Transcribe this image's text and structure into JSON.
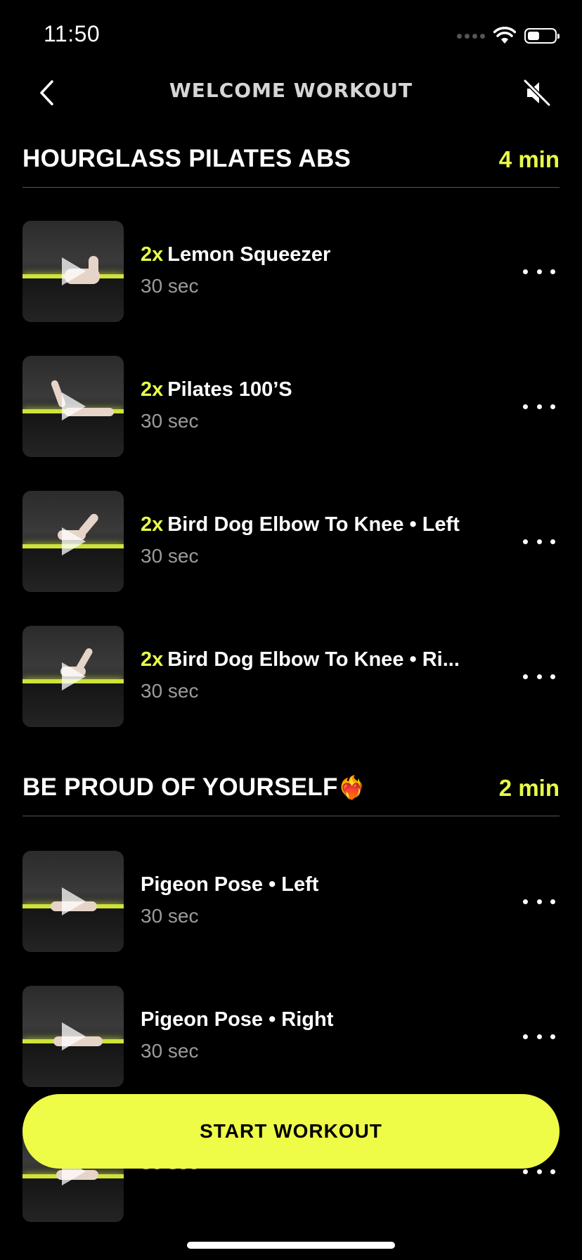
{
  "status_bar": {
    "time": "11:50",
    "battery_level": 0.45
  },
  "nav": {
    "title": "WELCOME WORKOUT",
    "back_icon": "chevron-left-icon",
    "mute_icon": "speaker-muted-icon"
  },
  "colors": {
    "accent": "#e8fc4a",
    "background": "#000000",
    "muted_text": "#9b9b9b"
  },
  "sections": [
    {
      "title": "HOURGLASS PILATES ABS",
      "duration": "4 min",
      "exercises": [
        {
          "reps": "2x",
          "name": "Lemon Squeezer",
          "time": "30 sec"
        },
        {
          "reps": "2x",
          "name": "Pilates 100’S",
          "time": "30 sec"
        },
        {
          "reps": "2x",
          "name": "Bird Dog Elbow To Knee • Left",
          "time": "30 sec"
        },
        {
          "reps": "2x",
          "name": "Bird Dog Elbow To Knee • Ri...",
          "time": "30 sec"
        }
      ]
    },
    {
      "title": "BE PROUD OF YOURSELF",
      "emoji": "❤️‍🔥",
      "duration": "2 min",
      "exercises": [
        {
          "reps": "",
          "name": "Pigeon Pose • Left",
          "time": "30 sec"
        },
        {
          "reps": "",
          "name": "Pigeon Pose • Right",
          "time": "30 sec"
        },
        {
          "reps": "",
          "name": "",
          "time": "30 sec"
        }
      ]
    }
  ],
  "start_button": {
    "label": "START WORKOUT"
  }
}
